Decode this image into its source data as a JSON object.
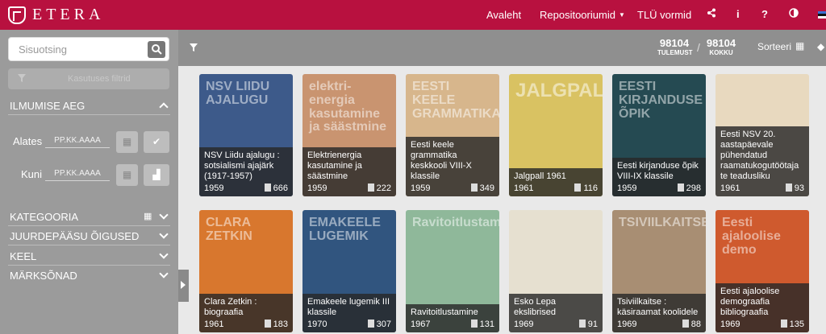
{
  "header": {
    "logo_text": "ETERA",
    "nav": [
      "Avaleht",
      "Repositooriumid",
      "TLÜ vormid"
    ],
    "icons": [
      "share-icon",
      "info-icon",
      "help-icon",
      "contrast-icon",
      "flag-icon"
    ]
  },
  "sidebar": {
    "search_placeholder": "Sisuotsing",
    "filters_button": "Kasutuses filtrid",
    "date_section": "ILMUMISE AEG",
    "from_label": "Alates",
    "to_label": "Kuni",
    "date_placeholder": "PP.KK.AAAA",
    "sections": [
      "KATEGOORIA",
      "JUURDEPÄÄSU ÕIGUSED",
      "KEEL",
      "MÄRKSÕNAD"
    ]
  },
  "results": {
    "shown": "98104",
    "shown_label": "TULEMUST",
    "total": "98104",
    "total_label": "KOKKU",
    "sort_label": "Sorteeri"
  },
  "cards": [
    {
      "title": "NSV Liidu ajalugu : sotsialismi ajajärk (1917-1957)",
      "year": "1959",
      "pages": "666",
      "color": "#3d5a8a",
      "cover_text": "NSV LIIDU AJALUGU"
    },
    {
      "title": "Elektrienergia kasutamine ja säästmine",
      "year": "1959",
      "pages": "222",
      "color": "#c99470",
      "cover_text": "elektri-energia kasutamine ja säästmine"
    },
    {
      "title": "Eesti keele grammatika keskkooli VIII-X klassile",
      "year": "1959",
      "pages": "349",
      "color": "#d7b68c",
      "cover_text": "EESTI KEELE GRAMMATIKA"
    },
    {
      "title": "Jalgpall 1961",
      "year": "1961",
      "pages": "116",
      "color": "#d9c262",
      "cover_text": "JALGPALL"
    },
    {
      "title": "Eesti kirjanduse õpik VIII-IX klassile",
      "year": "1959",
      "pages": "298",
      "color": "#254a52",
      "cover_text": "EESTI KIRJANDUSE ÕPIK"
    },
    {
      "title": "Eesti NSV 20. aastapäevale pühendatud raamatukogutöötaja te teadusliku",
      "year": "1961",
      "pages": "93",
      "color": "#e8d9bf",
      "cover_text": ""
    },
    {
      "title": "Clara Zetkin : biograafia",
      "year": "1961",
      "pages": "183",
      "color": "#d8772e",
      "cover_text": "CLARA ZETKIN"
    },
    {
      "title": "Emakeele lugemik III klassile",
      "year": "1970",
      "pages": "307",
      "color": "#31557f",
      "cover_text": "EMAKEELE LUGEMIK"
    },
    {
      "title": "Ravitoitlustamine",
      "year": "1967",
      "pages": "131",
      "color": "#8fb89a",
      "cover_text": "Ravitoitlustamine"
    },
    {
      "title": "Esko Lepa ekslibrised",
      "year": "1969",
      "pages": "91",
      "color": "#e6e0d0",
      "cover_text": ""
    },
    {
      "title": "Tsiviilkaitse : käsiraamat koolidele",
      "year": "1969",
      "pages": "88",
      "color": "#a88e73",
      "cover_text": "TSIVIILKAITSE"
    },
    {
      "title": "Eesti ajaloolise demograafia bibliograafia",
      "year": "1969",
      "pages": "135",
      "color": "#cf5a2e",
      "cover_text": "Eesti ajaloolise demo"
    }
  ]
}
